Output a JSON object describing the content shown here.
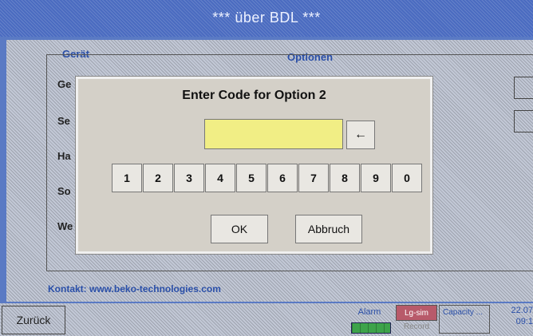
{
  "window": {
    "title": "*** über BDL ***"
  },
  "background": {
    "section_left": "Gerät",
    "section_right": "Optionen",
    "row_labels": [
      "Ge",
      "Se",
      "Ha",
      "So",
      "We"
    ],
    "contact": "Kontakt: www.beko-technologies.com"
  },
  "dialog": {
    "title": "Enter Code for Option 2",
    "code_value": "",
    "backspace_glyph": "←",
    "keys": [
      "1",
      "2",
      "3",
      "4",
      "5",
      "6",
      "7",
      "8",
      "9",
      "0"
    ],
    "ok_label": "OK",
    "cancel_label": "Abbruch"
  },
  "footer": {
    "back_label": "Zurück",
    "alarm_label": "Alarm",
    "lgsim_label": "Lg-sim",
    "record_label": "Record",
    "capacity_label": "Capacity ...",
    "date": "22.07",
    "time": "09:1"
  },
  "colors": {
    "title_bar": "#4a6bc0",
    "input_bg": "#f1ee85",
    "alarm_ok": "#3da34a",
    "lgsim": "#b85a6a"
  }
}
